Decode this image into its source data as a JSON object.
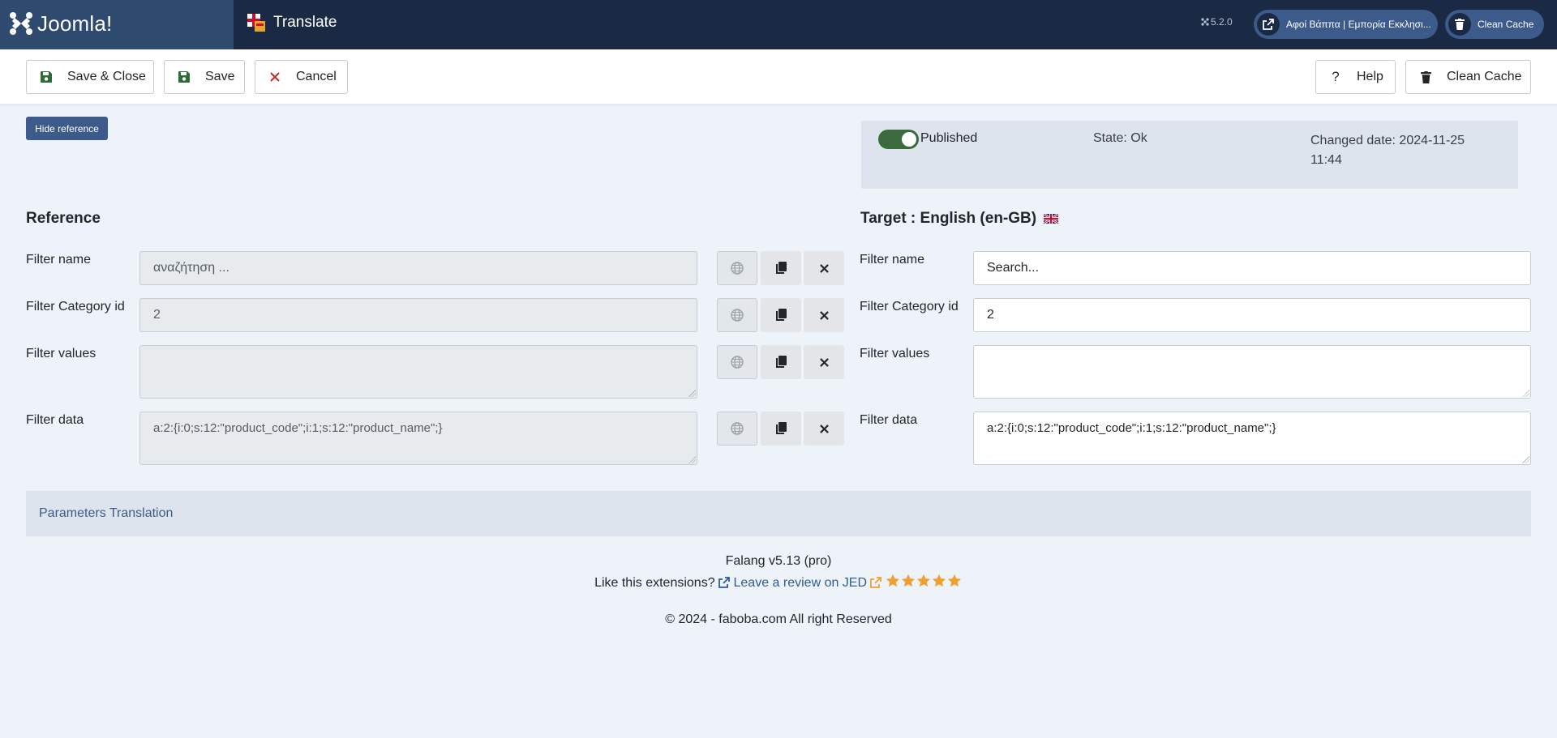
{
  "header": {
    "logo_text": "Joomla!",
    "page_title": "Translate",
    "version": "5.2.0",
    "site_link_label": "Αφοί Βάππα | Εμπορία Εκκλησι...",
    "clean_cache_label": "Clean Cache"
  },
  "toolbar": {
    "save_close": "Save & Close",
    "save": "Save",
    "cancel": "Cancel",
    "help": "Help",
    "clean_cache": "Clean Cache"
  },
  "hide_reference": "Hide reference",
  "status": {
    "published_label": "Published",
    "published": true,
    "state": "State: Ok",
    "changed_date": "Changed date: 2024-11-25 11:44"
  },
  "reference": {
    "title": "Reference",
    "fields": [
      {
        "label": "Filter name",
        "value": "αναζήτηση ..."
      },
      {
        "label": "Filter Category id",
        "value": "2"
      },
      {
        "label": "Filter values",
        "value": ""
      },
      {
        "label": "Filter data",
        "value": "a:2:{i:0;s:12:\"product_code\";i:1;s:12:\"product_name\";}"
      }
    ]
  },
  "target": {
    "title": "Target : English (en-GB)",
    "fields": [
      {
        "label": "Filter name",
        "value": "Search..."
      },
      {
        "label": "Filter Category id",
        "value": "2"
      },
      {
        "label": "Filter values",
        "value": ""
      },
      {
        "label": "Filter data",
        "value": "a:2:{i:0;s:12:\"product_code\";i:1;s:12:\"product_name\";}"
      }
    ]
  },
  "params_translation": "Parameters Translation",
  "footer": {
    "product": "Falang v5.13 (pro)",
    "review_question": "Like this extensions?",
    "review_link": "Leave a review on JED",
    "rating_stars": 5,
    "copyright": "© 2024 - faboba.com All right Reserved"
  },
  "colors": {
    "header_bg": "#1a2a44",
    "brand_bg": "#2f4a6f",
    "accent": "#3c5b8a",
    "toggle_on": "#3a6a3e",
    "star": "#f0a030"
  }
}
